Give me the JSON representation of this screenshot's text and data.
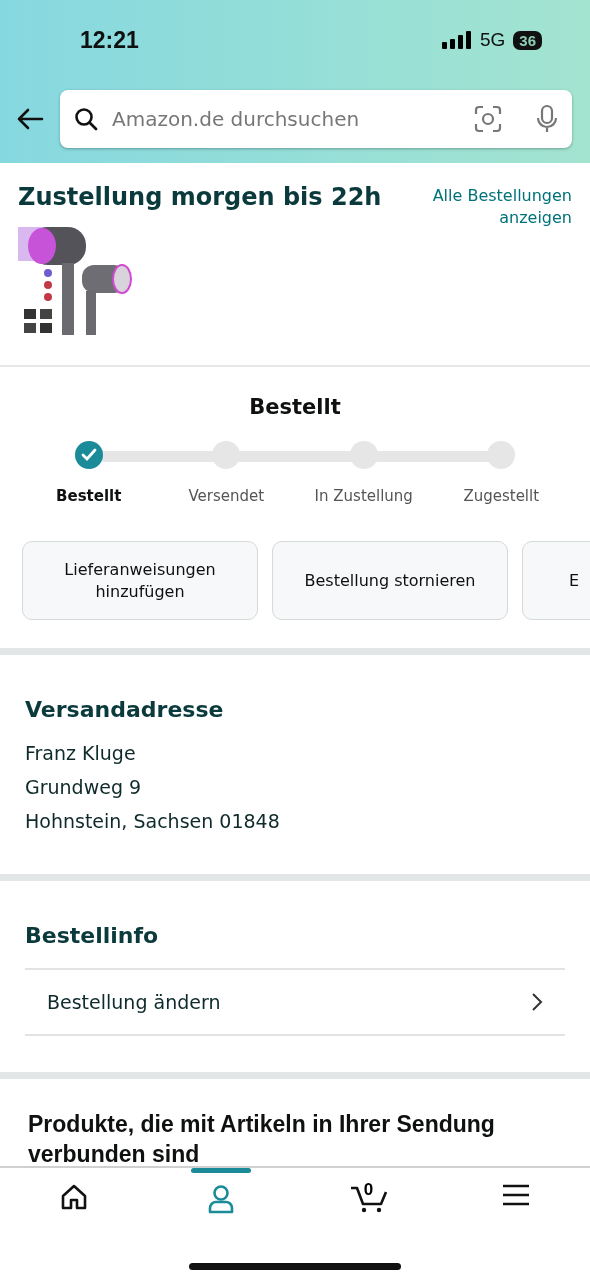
{
  "status_bar": {
    "time": "12:21",
    "network": "5G",
    "battery": "36"
  },
  "search": {
    "placeholder": "Amazon.de durchsuchen"
  },
  "delivery": {
    "title": "Zustellung morgen bis 22h",
    "link": "Alle Bestellungen anzeigen"
  },
  "tracker": {
    "title": "Bestellt",
    "steps": [
      {
        "label": "Bestellt",
        "done": true
      },
      {
        "label": "Versendet",
        "done": false
      },
      {
        "label": "In Zustellung",
        "done": false
      },
      {
        "label": "Zugestellt",
        "done": false
      }
    ]
  },
  "actions": [
    "Lieferanweisungen hinzufügen",
    "Bestellung stornieren",
    "E"
  ],
  "address": {
    "title": "Versandadresse",
    "lines": [
      "Franz Kluge",
      "Grundweg 9",
      "Hohnstein, Sachsen 01848"
    ]
  },
  "order_info": {
    "title": "Bestellinfo",
    "rows": [
      "Bestellung ändern"
    ]
  },
  "related": {
    "title": "Produkte, die mit Artikeln in Ihrer Sendung verbunden sind"
  },
  "tab_bar": {
    "items": [
      {
        "kind": "home",
        "selected": false
      },
      {
        "kind": "account",
        "selected": true
      },
      {
        "kind": "cart",
        "selected": false,
        "badge": "0"
      },
      {
        "kind": "menu",
        "selected": false
      }
    ]
  }
}
